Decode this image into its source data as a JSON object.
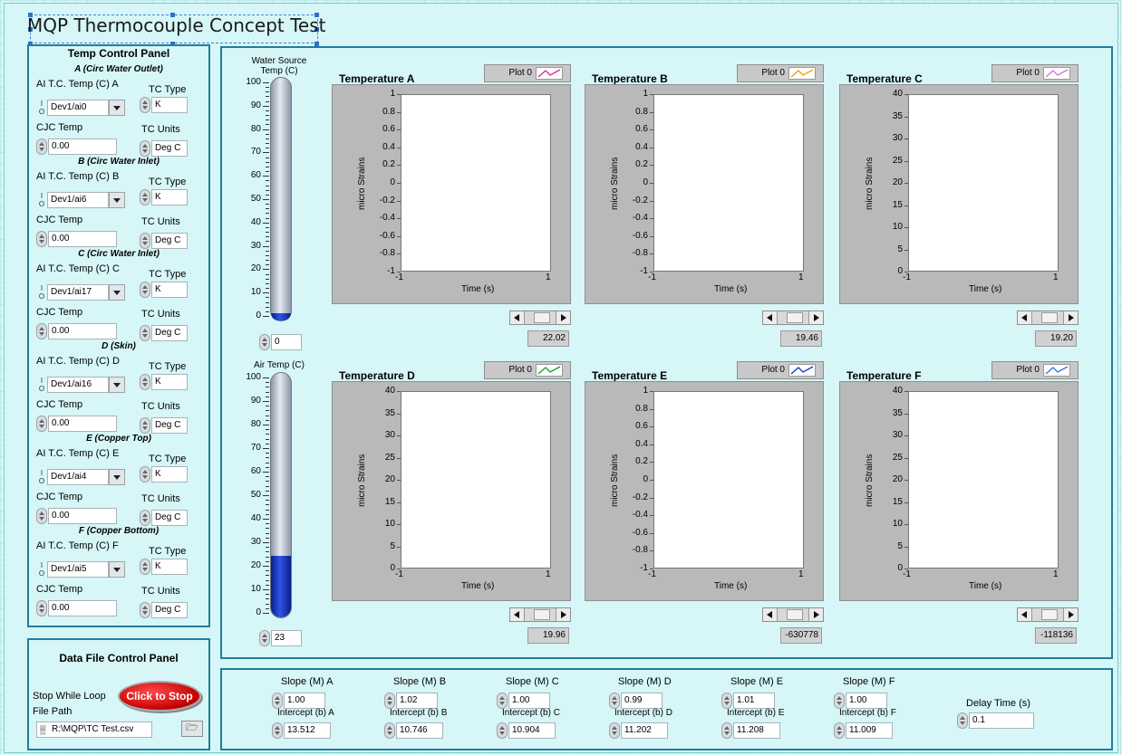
{
  "title": "MQP Thermocouple Concept Test",
  "temp_panel": {
    "title": "Temp Control Panel",
    "channels": [
      {
        "header": "A (Circ Water Outlet)",
        "ai_label": "AI T.C. Temp (C) A",
        "ai_value": "Dev1/ai0",
        "tc_type_label": "TC Type",
        "tc_type": "K",
        "cjc_label": "CJC Temp",
        "cjc_value": "0.00",
        "tc_units_label": "TC Units",
        "tc_units": "Deg C"
      },
      {
        "header": "B (Circ Water Inlet)",
        "ai_label": "AI T.C. Temp (C) B",
        "ai_value": "Dev1/ai6",
        "tc_type_label": "TC Type",
        "tc_type": "K",
        "cjc_label": "CJC Temp",
        "cjc_value": "0.00",
        "tc_units_label": "TC Units",
        "tc_units": "Deg C"
      },
      {
        "header": "C (Circ Water Inlet)",
        "ai_label": "AI T.C. Temp (C) C",
        "ai_value": "Dev1/ai17",
        "tc_type_label": "TC Type",
        "tc_type": "K",
        "cjc_label": "CJC Temp",
        "cjc_value": "0.00",
        "tc_units_label": "TC Units",
        "tc_units": "Deg C"
      },
      {
        "header": "D (Skin)",
        "ai_label": "AI T.C. Temp (C) D",
        "ai_value": "Dev1/ai16",
        "tc_type_label": "TC Type",
        "tc_type": "K",
        "cjc_label": "CJC Temp",
        "cjc_value": "0.00",
        "tc_units_label": "TC Units",
        "tc_units": "Deg C"
      },
      {
        "header": "E (Copper Top)",
        "ai_label": "AI T.C. Temp (C) E",
        "ai_value": "Dev1/ai4",
        "tc_type_label": "TC Type",
        "tc_type": "K",
        "cjc_label": "CJC Temp",
        "cjc_value": "0.00",
        "tc_units_label": "TC Units",
        "tc_units": "Deg C"
      },
      {
        "header": "F (Copper Bottom)",
        "ai_label": "AI T.C. Temp (C) F",
        "ai_value": "Dev1/ai5",
        "tc_type_label": "TC Type",
        "tc_type": "K",
        "cjc_label": "CJC Temp",
        "cjc_value": "0.00",
        "tc_units_label": "TC Units",
        "tc_units": "Deg C"
      }
    ]
  },
  "data_panel": {
    "title": "Data File Control Panel",
    "stop_label": "Stop While Loop",
    "stop_button": "Click to Stop",
    "file_path_label": "File Path",
    "file_path": "R:\\MQP\\TC Test.csv",
    "path_icon": "path-icon",
    "browse_icon": "folder-icon"
  },
  "thermometers": [
    {
      "label": "Water Source Temp (C)",
      "value": "0",
      "level": 0,
      "scale": [
        "100",
        "90",
        "80",
        "70",
        "60",
        "50",
        "40",
        "30",
        "20",
        "10",
        "0"
      ]
    },
    {
      "label": "Air Temp (C)",
      "value": "23",
      "level": 23,
      "scale": [
        "100",
        "90",
        "80",
        "70",
        "60",
        "50",
        "40",
        "30",
        "20",
        "10",
        "0"
      ]
    }
  ],
  "chart_data": [
    {
      "type": "line",
      "title": "Temperature A",
      "xlabel": "Time (s)",
      "ylabel": "micro Strains",
      "xlim": [
        -1,
        1
      ],
      "x_ticks": [
        "-1",
        "1"
      ],
      "ylim": [
        -1,
        1
      ],
      "y_ticks": [
        "1",
        "0.8",
        "0.6",
        "0.4",
        "0.2",
        "0",
        "-0.2",
        "-0.4",
        "-0.6",
        "-0.8",
        "-1"
      ],
      "legend": "Plot 0",
      "plot_color": "#e0209a",
      "readout": "22.02",
      "series": []
    },
    {
      "type": "line",
      "title": "Temperature B",
      "xlabel": "Time (s)",
      "ylabel": "micro Strains",
      "xlim": [
        -1,
        1
      ],
      "x_ticks": [
        "-1",
        "1"
      ],
      "ylim": [
        -1,
        1
      ],
      "y_ticks": [
        "1",
        "0.8",
        "0.6",
        "0.4",
        "0.2",
        "0",
        "-0.2",
        "-0.4",
        "-0.6",
        "-0.8",
        "-1"
      ],
      "legend": "Plot 0",
      "plot_color": "#f0a000",
      "readout": "19.46",
      "series": []
    },
    {
      "type": "line",
      "title": "Temperature C",
      "xlabel": "Time (s)",
      "ylabel": "micro Strains",
      "xlim": [
        -1,
        1
      ],
      "x_ticks": [
        "-1",
        "1"
      ],
      "ylim": [
        0,
        40
      ],
      "y_ticks": [
        "40",
        "35",
        "30",
        "25",
        "20",
        "15",
        "10",
        "5",
        "0"
      ],
      "legend": "Plot 0",
      "plot_color": "#d070e0",
      "readout": "19.20",
      "series": []
    },
    {
      "type": "line",
      "title": "Temperature D",
      "xlabel": "Time (s)",
      "ylabel": "micro Strains",
      "xlim": [
        -1,
        1
      ],
      "x_ticks": [
        "-1",
        "1"
      ],
      "ylim": [
        0,
        40
      ],
      "y_ticks": [
        "40",
        "35",
        "30",
        "25",
        "20",
        "15",
        "10",
        "5",
        "0"
      ],
      "legend": "Plot 0",
      "plot_color": "#10a020",
      "readout": "19.96",
      "series": []
    },
    {
      "type": "line",
      "title": "Temperature E",
      "xlabel": "Time (s)",
      "ylabel": "micro Strains",
      "xlim": [
        -1,
        1
      ],
      "x_ticks": [
        "-1",
        "1"
      ],
      "ylim": [
        -1,
        1
      ],
      "y_ticks": [
        "1",
        "0.8",
        "0.6",
        "0.4",
        "0.2",
        "0",
        "-0.2",
        "-0.4",
        "-0.6",
        "-0.8",
        "-1"
      ],
      "legend": "Plot 0",
      "plot_color": "#1030d0",
      "readout": "-630778",
      "series": []
    },
    {
      "type": "line",
      "title": "Temperature F",
      "xlabel": "Time (s)",
      "ylabel": "micro Strains",
      "xlim": [
        -1,
        1
      ],
      "x_ticks": [
        "-1",
        "1"
      ],
      "ylim": [
        0,
        40
      ],
      "y_ticks": [
        "40",
        "35",
        "30",
        "25",
        "20",
        "15",
        "10",
        "5",
        "0"
      ],
      "legend": "Plot 0",
      "plot_color": "#3070f0",
      "readout": "-118136",
      "series": []
    }
  ],
  "calibration": {
    "items": [
      {
        "slope_label": "Slope (M) A",
        "slope": "1.00",
        "intercept_label": "Intercept (b) A",
        "intercept": "13.512"
      },
      {
        "slope_label": "Slope (M) B",
        "slope": "1.02",
        "intercept_label": "Intercept (b) B",
        "intercept": "10.746"
      },
      {
        "slope_label": "Slope (M) C",
        "slope": "1.00",
        "intercept_label": "Intercept (b) C",
        "intercept": "10.904"
      },
      {
        "slope_label": "Slope (M) D",
        "slope": "0.99",
        "intercept_label": "Intercept (b) D",
        "intercept": "11.202"
      },
      {
        "slope_label": "Slope (M) E",
        "slope": "1.01",
        "intercept_label": "Intercept (b) E",
        "intercept": "11.208"
      },
      {
        "slope_label": "Slope (M) F",
        "slope": "1.00",
        "intercept_label": "Intercept (b) F",
        "intercept": "11.009"
      }
    ],
    "delay_label": "Delay Time (s)",
    "delay": "0.1"
  }
}
